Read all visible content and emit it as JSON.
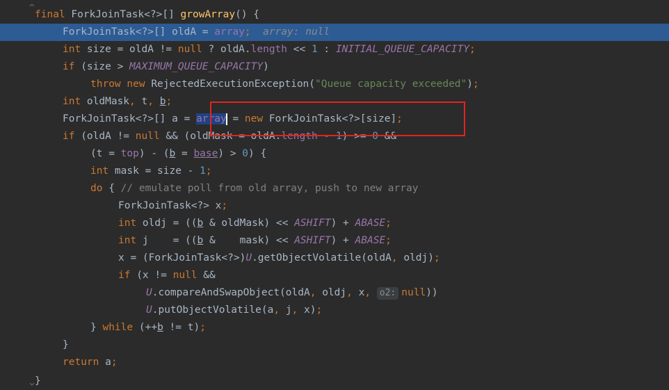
{
  "editor": {
    "language": "java",
    "highlighted_line": 2,
    "lines": [
      {
        "n": 0,
        "parts": [
          {
            "c": "kw",
            "t": "final "
          },
          {
            "c": "",
            "t": "ForkJoinTask<?>[] "
          },
          {
            "c": "fn",
            "t": "growArray"
          },
          {
            "c": "",
            "t": "() {"
          }
        ]
      },
      {
        "n": 1,
        "parts": [
          {
            "c": "",
            "t": "ForkJoinTask<?>[] oldA = "
          },
          {
            "c": "fld",
            "t": "array"
          },
          {
            "c": "kw",
            "t": ";"
          },
          {
            "c": "inl",
            "t": "  array: null"
          }
        ]
      },
      {
        "n": 2,
        "parts": [
          {
            "c": "kw",
            "t": "int "
          },
          {
            "c": "",
            "t": "size = oldA != "
          },
          {
            "c": "kw",
            "t": "null "
          },
          {
            "c": "",
            "t": "? oldA."
          },
          {
            "c": "fld",
            "t": "length "
          },
          {
            "c": "",
            "t": "<< "
          },
          {
            "c": "num",
            "t": "1 "
          },
          {
            "c": "",
            "t": ": "
          },
          {
            "c": "cst",
            "t": "INITIAL_QUEUE_CAPACITY"
          },
          {
            "c": "kw",
            "t": ";"
          }
        ]
      },
      {
        "n": 3,
        "parts": [
          {
            "c": "kw",
            "t": "if "
          },
          {
            "c": "",
            "t": "(size > "
          },
          {
            "c": "cst",
            "t": "MAXIMUM_QUEUE_CAPACITY"
          },
          {
            "c": "",
            "t": ")"
          }
        ]
      },
      {
        "n": 4,
        "parts": [
          {
            "c": "kw",
            "t": "throw new "
          },
          {
            "c": "",
            "t": "RejectedExecutionException("
          },
          {
            "c": "str",
            "t": "\"Queue capacity exceeded\""
          },
          {
            "c": "",
            "t": ")"
          },
          {
            "c": "kw",
            "t": ";"
          }
        ]
      },
      {
        "n": 5,
        "parts": [
          {
            "c": "kw",
            "t": "int "
          },
          {
            "c": "",
            "t": "oldMask"
          },
          {
            "c": "kw",
            "t": ", "
          },
          {
            "c": "",
            "t": "t"
          },
          {
            "c": "kw",
            "t": ", "
          },
          {
            "c": "ul",
            "t": "b"
          },
          {
            "c": "kw",
            "t": ";"
          }
        ]
      },
      {
        "n": 6,
        "parts": [
          {
            "c": "",
            "t": "ForkJoinTask<?>[] a = "
          },
          {
            "c": "fld sel",
            "t": "array"
          },
          {
            "c": "caret",
            "t": ""
          },
          {
            "c": "",
            "t": " = "
          },
          {
            "c": "kw",
            "t": "new "
          },
          {
            "c": "",
            "t": "ForkJoinTask<?>[size]"
          },
          {
            "c": "kw",
            "t": ";"
          }
        ]
      },
      {
        "n": 7,
        "parts": [
          {
            "c": "kw",
            "t": "if "
          },
          {
            "c": "",
            "t": "(oldA != "
          },
          {
            "c": "kw",
            "t": "null "
          },
          {
            "c": "",
            "t": "&& (oldMask = oldA."
          },
          {
            "c": "fld",
            "t": "length "
          },
          {
            "c": "",
            "t": "- "
          },
          {
            "c": "num",
            "t": "1"
          },
          {
            "c": "",
            "t": ") >= "
          },
          {
            "c": "num",
            "t": "0 "
          },
          {
            "c": "",
            "t": "&&"
          }
        ]
      },
      {
        "n": 8,
        "parts": [
          {
            "c": "",
            "t": "(t = "
          },
          {
            "c": "fld",
            "t": "top"
          },
          {
            "c": "",
            "t": ") - ("
          },
          {
            "c": "ul",
            "t": "b"
          },
          {
            "c": "",
            "t": " = "
          },
          {
            "c": "fld ul",
            "t": "base"
          },
          {
            "c": "",
            "t": ") > "
          },
          {
            "c": "num",
            "t": "0"
          },
          {
            "c": "",
            "t": ") {"
          }
        ]
      },
      {
        "n": 9,
        "parts": [
          {
            "c": "kw",
            "t": "int "
          },
          {
            "c": "",
            "t": "mask = size - "
          },
          {
            "c": "num",
            "t": "1"
          },
          {
            "c": "kw",
            "t": ";"
          }
        ]
      },
      {
        "n": 10,
        "parts": [
          {
            "c": "kw",
            "t": "do "
          },
          {
            "c": "",
            "t": "{ "
          },
          {
            "c": "cmt",
            "t": "// emulate poll from old array, push to new array"
          }
        ]
      },
      {
        "n": 11,
        "parts": [
          {
            "c": "",
            "t": "ForkJoinTask<?> x"
          },
          {
            "c": "kw",
            "t": ";"
          }
        ]
      },
      {
        "n": 12,
        "parts": [
          {
            "c": "kw",
            "t": "int "
          },
          {
            "c": "",
            "t": "oldj = (("
          },
          {
            "c": "ul",
            "t": "b"
          },
          {
            "c": "",
            "t": " & oldMask) << "
          },
          {
            "c": "cst",
            "t": "ASHIFT"
          },
          {
            "c": "",
            "t": ") + "
          },
          {
            "c": "cst",
            "t": "ABASE"
          },
          {
            "c": "kw",
            "t": ";"
          }
        ]
      },
      {
        "n": 13,
        "parts": [
          {
            "c": "kw",
            "t": "int "
          },
          {
            "c": "",
            "t": "j    = (("
          },
          {
            "c": "ul",
            "t": "b"
          },
          {
            "c": "",
            "t": " &    mask) << "
          },
          {
            "c": "cst",
            "t": "ASHIFT"
          },
          {
            "c": "",
            "t": ") + "
          },
          {
            "c": "cst",
            "t": "ABASE"
          },
          {
            "c": "kw",
            "t": ";"
          }
        ]
      },
      {
        "n": 14,
        "parts": [
          {
            "c": "",
            "t": "x = (ForkJoinTask<?>)"
          },
          {
            "c": "cst",
            "t": "U"
          },
          {
            "c": "",
            "t": ".getObjectVolatile(oldA"
          },
          {
            "c": "kw",
            "t": ", "
          },
          {
            "c": "",
            "t": "oldj)"
          },
          {
            "c": "kw",
            "t": ";"
          }
        ]
      },
      {
        "n": 15,
        "parts": [
          {
            "c": "kw",
            "t": "if "
          },
          {
            "c": "",
            "t": "(x != "
          },
          {
            "c": "kw",
            "t": "null "
          },
          {
            "c": "",
            "t": "&&"
          }
        ]
      },
      {
        "n": 16,
        "parts": [
          {
            "c": "cst",
            "t": "U"
          },
          {
            "c": "",
            "t": ".compareAndSwapObject(oldA"
          },
          {
            "c": "kw",
            "t": ", "
          },
          {
            "c": "",
            "t": "oldj"
          },
          {
            "c": "kw",
            "t": ", "
          },
          {
            "c": "",
            "t": "x"
          },
          {
            "c": "kw",
            "t": ", "
          },
          {
            "c": "hint",
            "t": "o2:"
          },
          {
            "c": "kw",
            "t": "null"
          },
          {
            "c": "",
            "t": "))"
          }
        ]
      },
      {
        "n": 17,
        "parts": [
          {
            "c": "cst",
            "t": "U"
          },
          {
            "c": "",
            "t": ".putObjectVolatile(a"
          },
          {
            "c": "kw",
            "t": ", "
          },
          {
            "c": "",
            "t": "j"
          },
          {
            "c": "kw",
            "t": ", "
          },
          {
            "c": "",
            "t": "x)"
          },
          {
            "c": "kw",
            "t": ";"
          }
        ]
      },
      {
        "n": 18,
        "parts": [
          {
            "c": "",
            "t": "} "
          },
          {
            "c": "kw",
            "t": "while "
          },
          {
            "c": "",
            "t": "(++"
          },
          {
            "c": "ul",
            "t": "b"
          },
          {
            "c": "",
            "t": " != t)"
          },
          {
            "c": "kw",
            "t": ";"
          }
        ]
      },
      {
        "n": 19,
        "parts": [
          {
            "c": "",
            "t": "}"
          }
        ]
      },
      {
        "n": 20,
        "parts": [
          {
            "c": "kw",
            "t": "return "
          },
          {
            "c": "",
            "t": "a"
          },
          {
            "c": "kw",
            "t": ";"
          }
        ]
      },
      {
        "n": 21,
        "parts": [
          {
            "c": "",
            "t": "}"
          }
        ]
      }
    ]
  },
  "colors": {
    "background": "#2b2b2b",
    "execution_line": "#2d5b94",
    "annotation_box": "#e0251f",
    "keyword": "#cc7832",
    "field": "#9876aa",
    "string": "#6a8759",
    "number": "#6897bb",
    "comment": "#808080"
  }
}
